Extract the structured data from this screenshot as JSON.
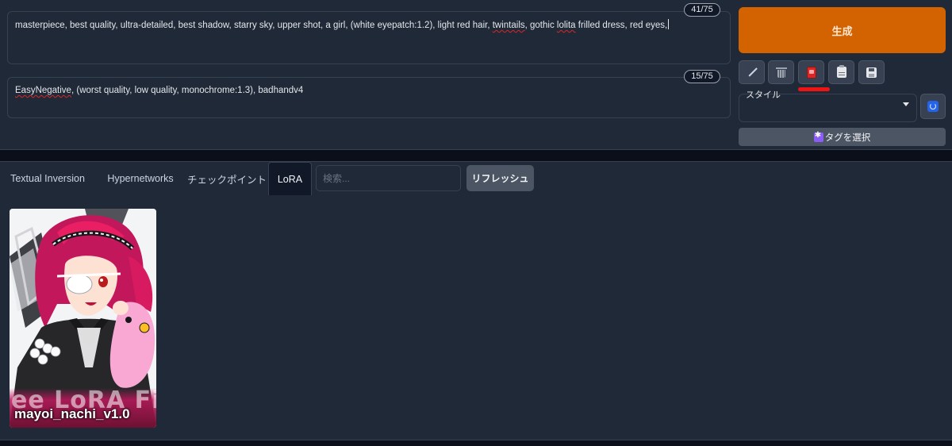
{
  "prompt": {
    "positive": {
      "text_parts": [
        {
          "t": "masterpiece, best quality, ultra-detailed, best shadow, starry sky, upper shot, a girl, (white eyepatch:1.2), light red hair, ",
          "spell": false
        },
        {
          "t": "twintails",
          "spell": true
        },
        {
          "t": ", gothic ",
          "spell": false
        },
        {
          "t": "lolita",
          "spell": true
        },
        {
          "t": " frilled dress, red eyes,",
          "spell": false
        }
      ],
      "token_count": "41/75"
    },
    "negative": {
      "text_parts": [
        {
          "t": "EasyNegative",
          "spell": true
        },
        {
          "t": ", (worst quality, low quality, monochrome:1.3), badhandv4",
          "spell": false
        }
      ],
      "token_count": "15/75"
    }
  },
  "generate": {
    "label": "生成",
    "color": "#d36200"
  },
  "toolbar": {
    "buttons": [
      {
        "icon": "arrow-icon"
      },
      {
        "icon": "trash-icon"
      },
      {
        "icon": "extra-networks-icon"
      },
      {
        "icon": "clipboard-icon"
      },
      {
        "icon": "save-icon"
      }
    ],
    "highlight_color": "#ef1414"
  },
  "styles": {
    "label": "スタイル",
    "selected": ""
  },
  "tag_select": {
    "label": "タグを選択",
    "icon": "tag-icon"
  },
  "tabs": [
    {
      "label": "Textual Inversion",
      "active": false
    },
    {
      "label": "Hypernetworks",
      "active": false
    },
    {
      "label": "チェックポイント",
      "active": false
    },
    {
      "label": "LoRA",
      "active": true
    }
  ],
  "search": {
    "placeholder": "検索...",
    "value": ""
  },
  "refresh": {
    "label": "リフレッシュ"
  },
  "cards": [
    {
      "title": "mayoi_nachi_v1.0",
      "watermark": "ee LoRA Fil"
    }
  ]
}
